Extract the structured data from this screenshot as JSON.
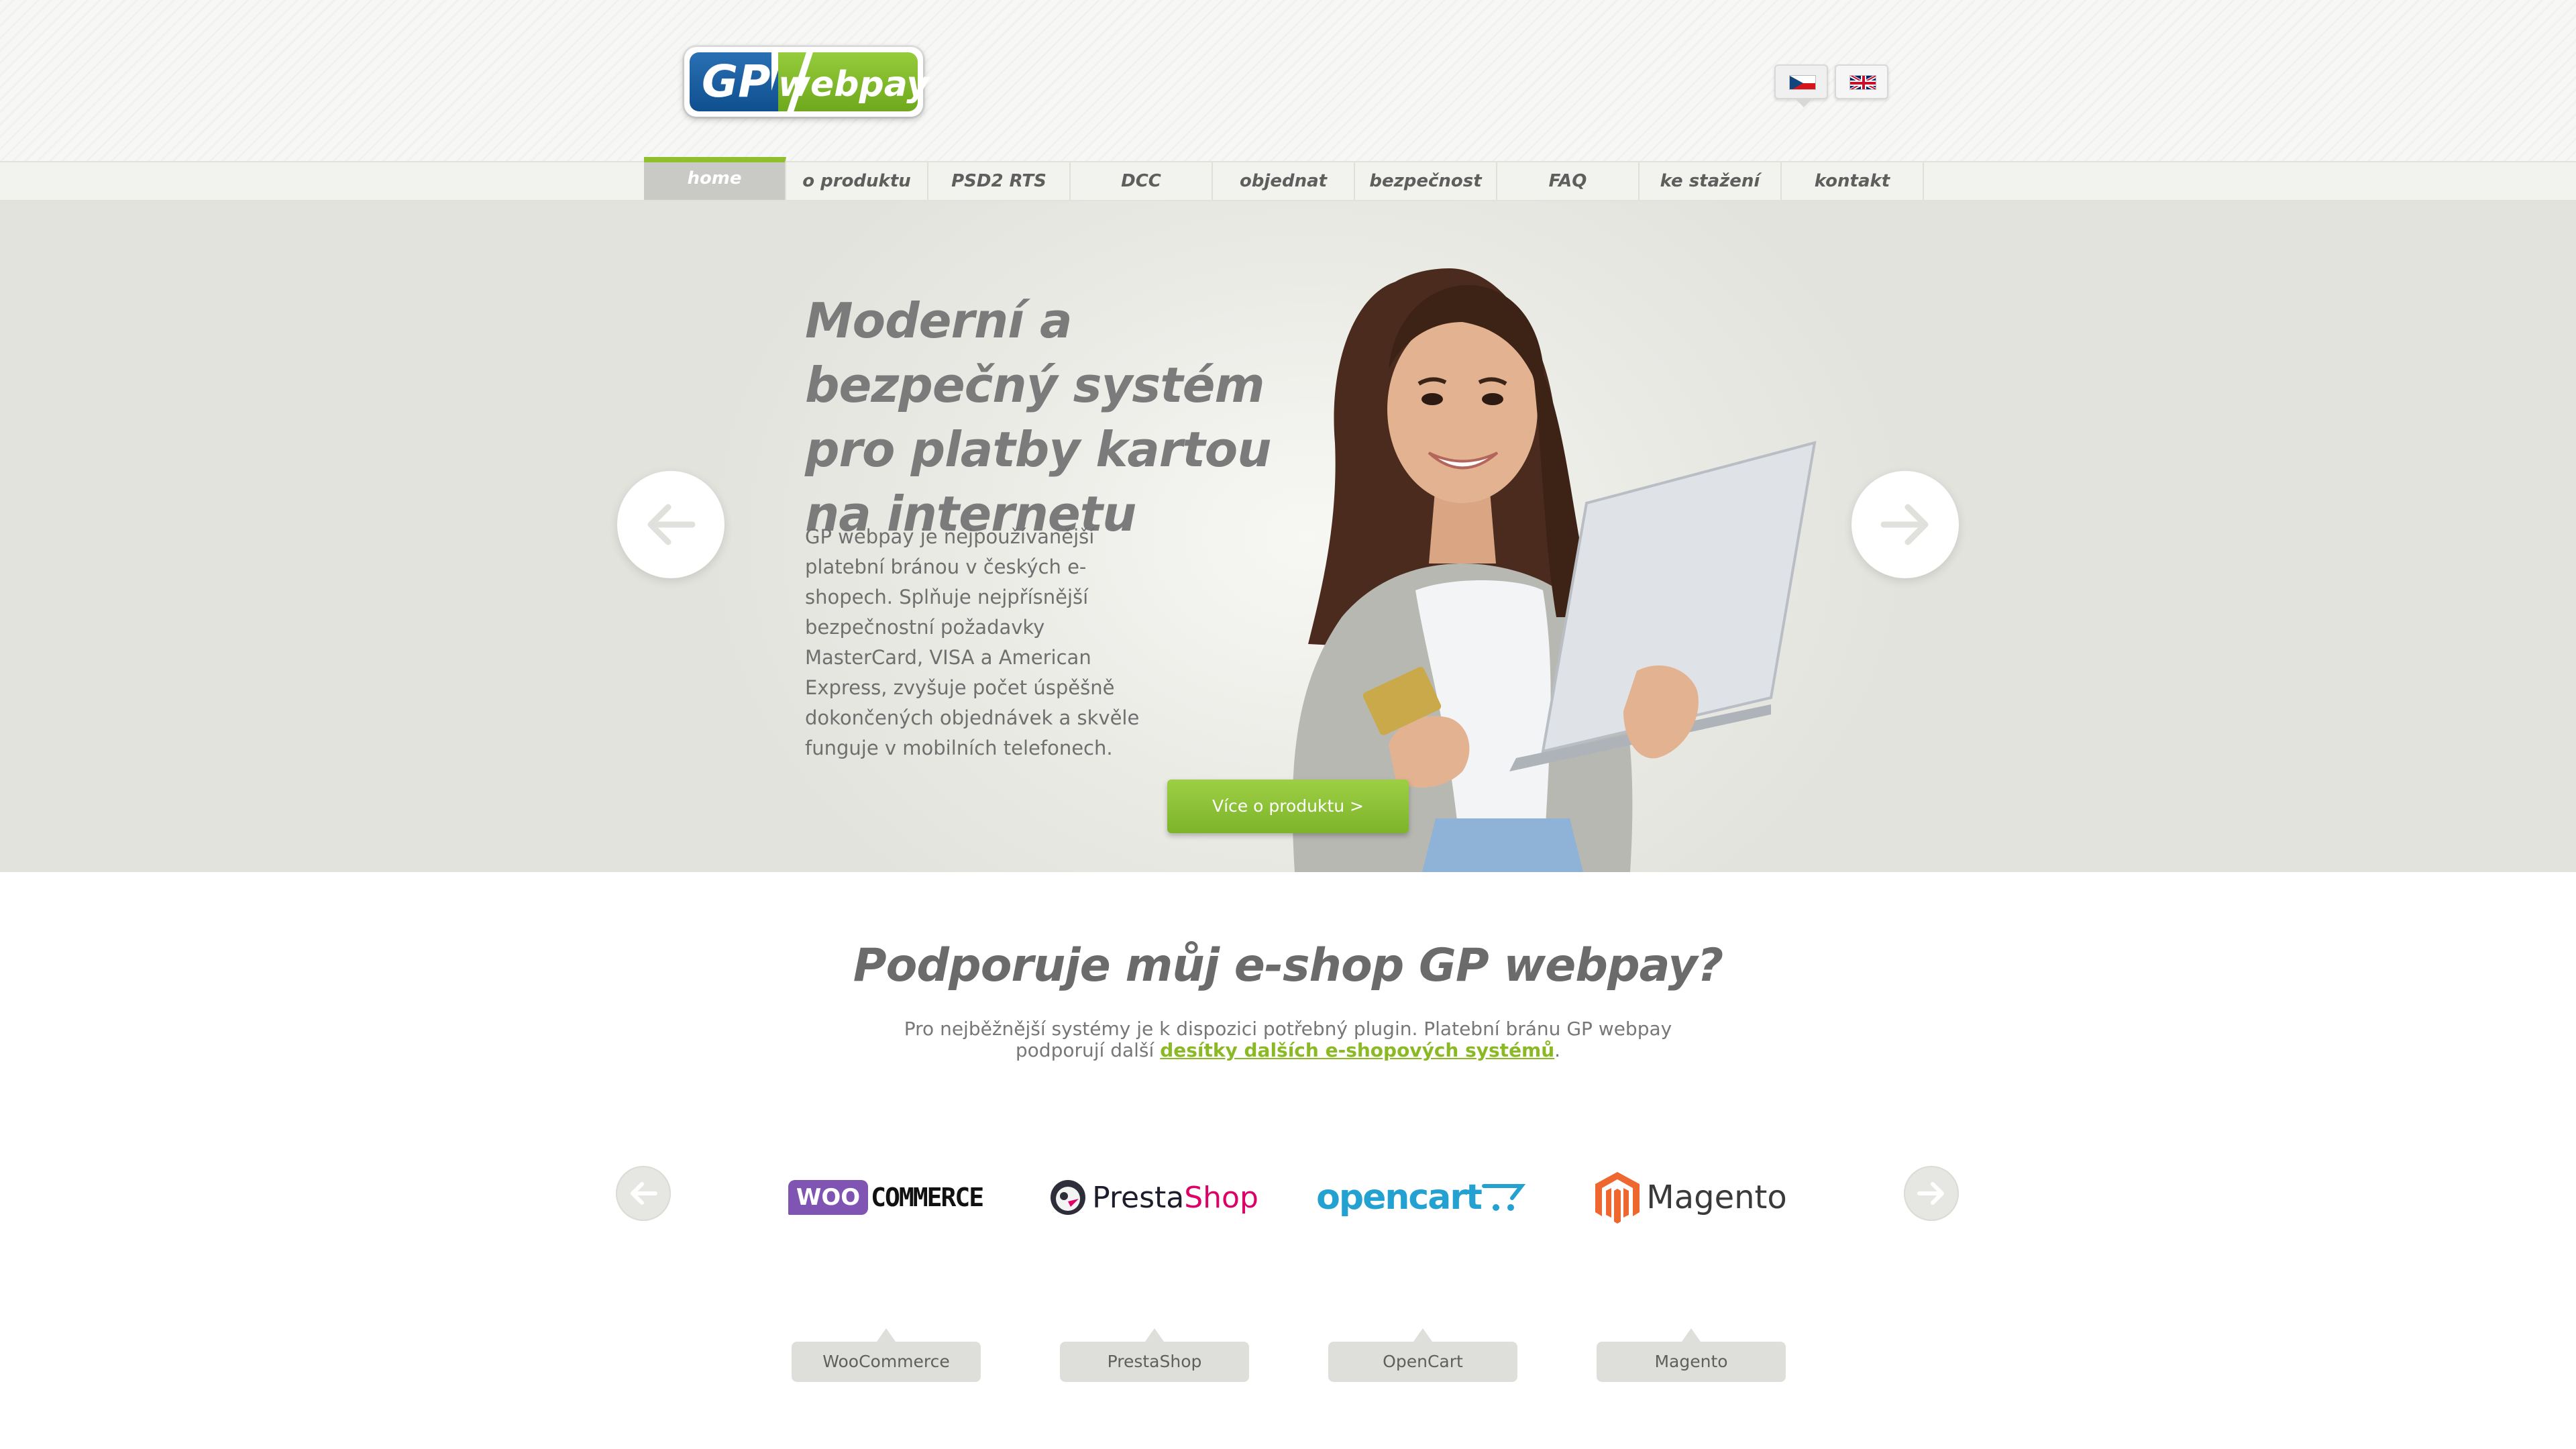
{
  "brand": {
    "logo_left": "GP",
    "logo_right": "webpay"
  },
  "languages": [
    {
      "code": "cz",
      "label": "Čeština",
      "active": true
    },
    {
      "code": "en",
      "label": "English",
      "active": false
    }
  ],
  "nav": {
    "items": [
      {
        "label": "home",
        "active": true
      },
      {
        "label": "o produktu"
      },
      {
        "label": "PSD2 RTS"
      },
      {
        "label": "DCC"
      },
      {
        "label": "objednat"
      },
      {
        "label": "bezpečnost"
      },
      {
        "label": "FAQ"
      },
      {
        "label": "ke stažení"
      },
      {
        "label": "kontakt"
      }
    ]
  },
  "hero": {
    "title": "Moderní a bezpečný systém pro platby kartou na internetu",
    "text": "GP webpay je nejpoužívanější platební bránou v českých e-shopech. Splňuje nejpřísnější bezpečnostní požadavky MasterCard, VISA a American Express, zvyšuje počet úspěšně dokončených objednávek a skvěle funguje v mobilních telefonech.",
    "button_label": "Více o produktu >",
    "prev_icon": "arrow-left-icon",
    "next_icon": "arrow-right-icon"
  },
  "plugins": {
    "title": "Podporuje můj e-shop GP webpay?",
    "text_before": "Pro nejběžnější systémy je k dispozici potřebný plugin. Platební bránu GP webpay podporují další",
    "link_label": "desítky dalších e-shopových systémů",
    "text_after": ".",
    "items": [
      {
        "label": "WooCommerce",
        "logo_a": "WOO",
        "logo_b": "COMMERCE"
      },
      {
        "label": "PrestaShop",
        "logo_a": "Presta",
        "logo_b": "Shop"
      },
      {
        "label": "OpenCart",
        "logo_a": "opencart"
      },
      {
        "label": "Magento",
        "logo_a": "Magento"
      }
    ]
  },
  "colors": {
    "accent_green": "#8fbf2b",
    "brand_blue": "#0e4f8f",
    "text_gray": "#6b6b6b",
    "hero_bg": "#e6e6e1"
  }
}
